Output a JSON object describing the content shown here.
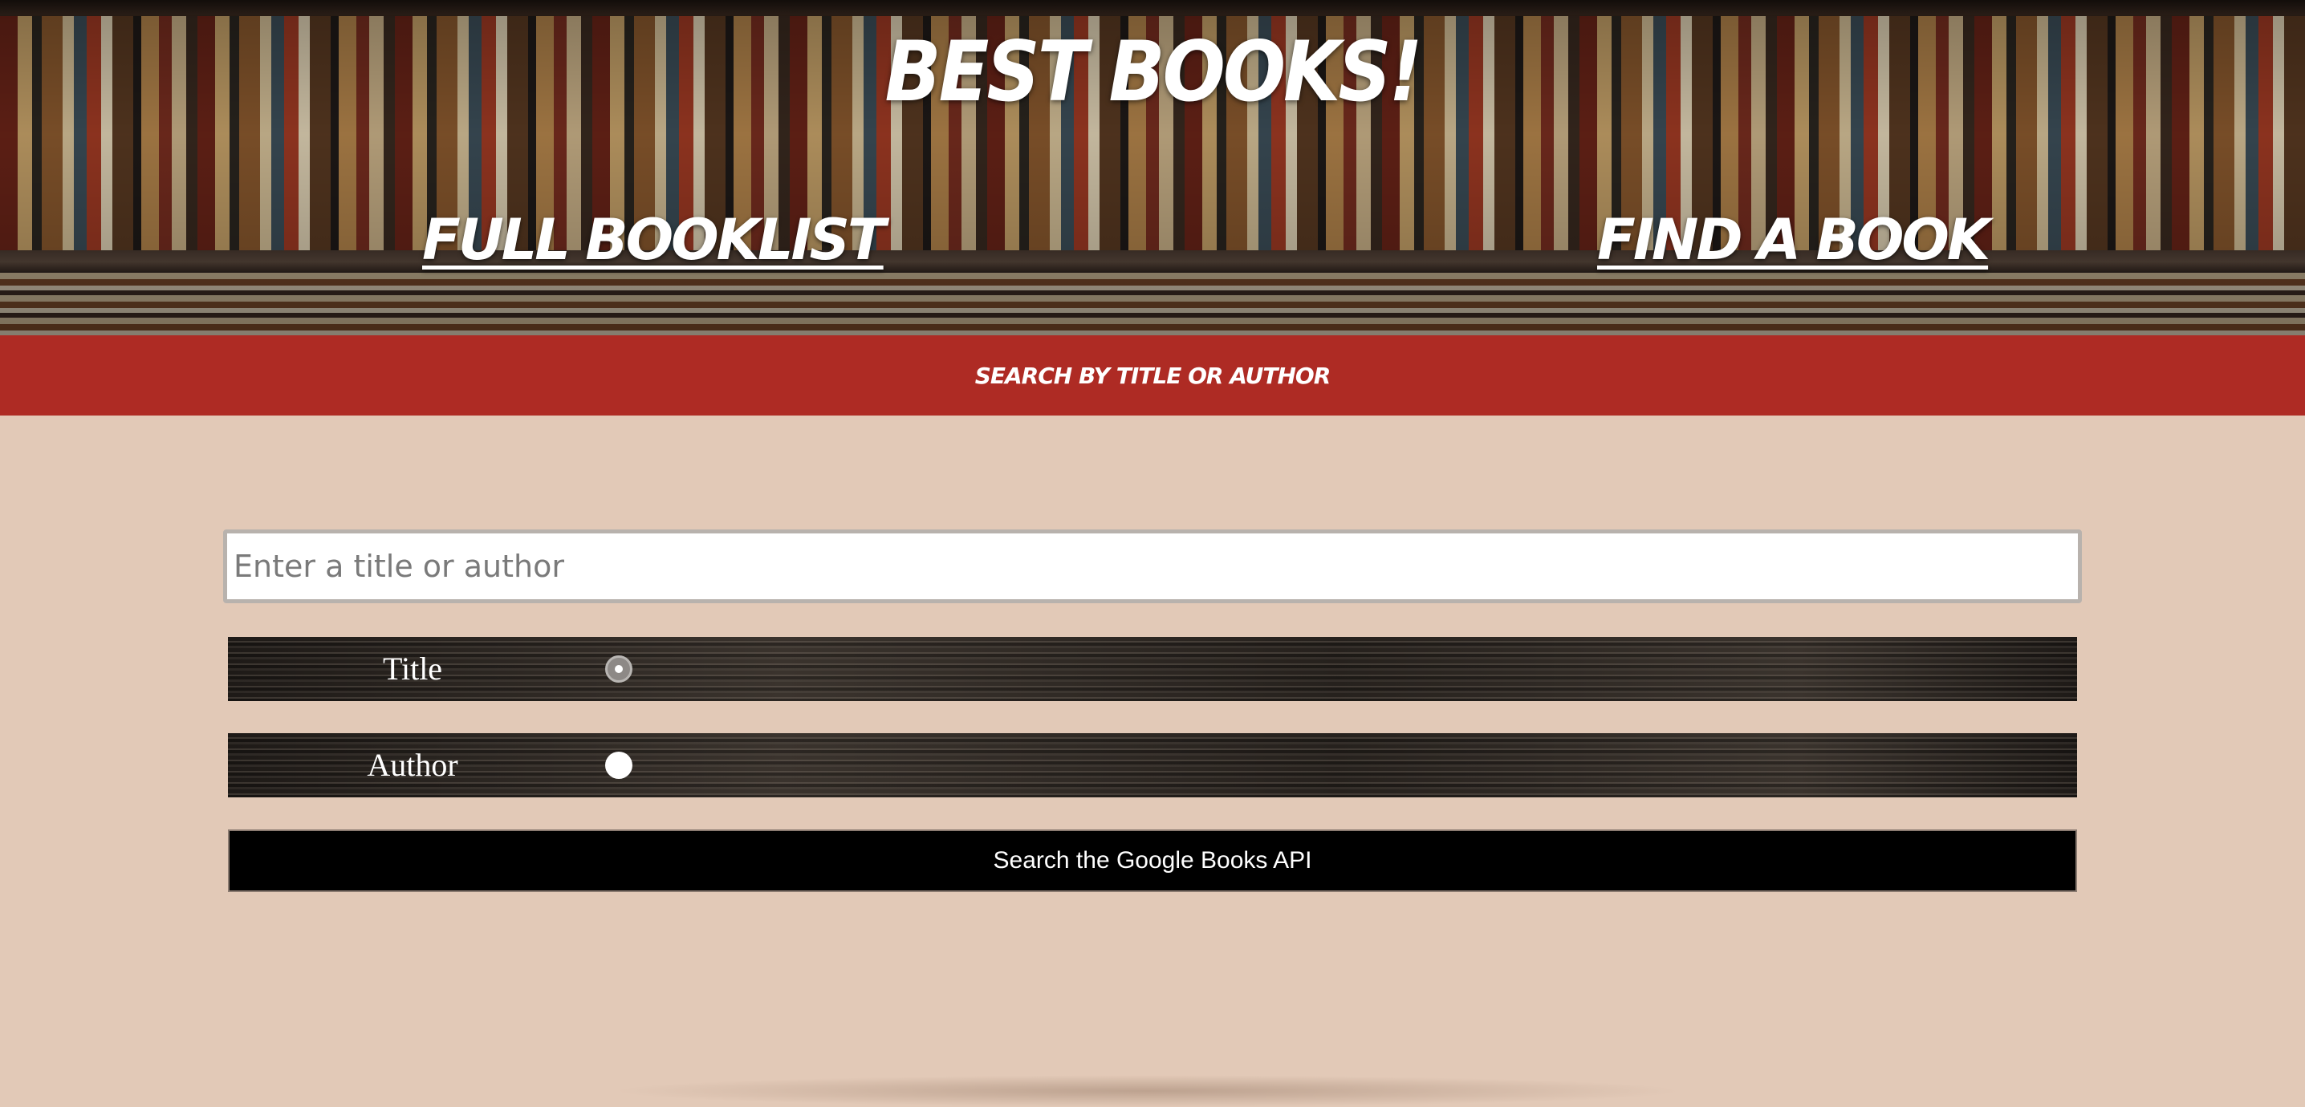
{
  "header": {
    "title": "BEST BOOKS!",
    "nav": [
      {
        "label": "FULL BOOKLIST"
      },
      {
        "label": "FIND A BOOK"
      }
    ]
  },
  "banner": {
    "text": "SEARCH BY TITLE OR AUTHOR",
    "color": "#ae2b24"
  },
  "search": {
    "placeholder": "Enter a title or author",
    "value": "",
    "options": [
      {
        "label": "Title",
        "checked": true
      },
      {
        "label": "Author",
        "checked": false
      }
    ],
    "button_label": "Search the Google Books API"
  },
  "colors": {
    "page_background": "#e2c9b7",
    "button_background": "#000000"
  }
}
